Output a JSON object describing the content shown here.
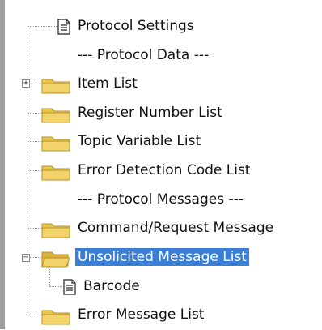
{
  "tree": {
    "items": [
      {
        "label": "Protocol Settings",
        "icon": "document-icon"
      },
      {
        "label": "--- Protocol Data ---",
        "icon": null
      },
      {
        "label": "Item List",
        "icon": "folder-icon",
        "expander": "+"
      },
      {
        "label": "Register Number List",
        "icon": "folder-icon"
      },
      {
        "label": "Topic Variable List",
        "icon": "folder-icon"
      },
      {
        "label": "Error Detection Code List",
        "icon": "folder-icon"
      },
      {
        "label": "--- Protocol Messages ---",
        "icon": null
      },
      {
        "label": "Command/Request Message",
        "icon": "folder-icon"
      },
      {
        "label": "Unsolicited Message List",
        "icon": "open-folder-icon",
        "expander": "−",
        "selected": true
      },
      {
        "label": "Barcode",
        "icon": "document-icon",
        "child": true
      },
      {
        "label": "Error Message List",
        "icon": "folder-icon"
      }
    ]
  },
  "colors": {
    "selection": "#3a7fd5",
    "folder": "#e8c64a",
    "tree_line": "#9a9a9a"
  }
}
